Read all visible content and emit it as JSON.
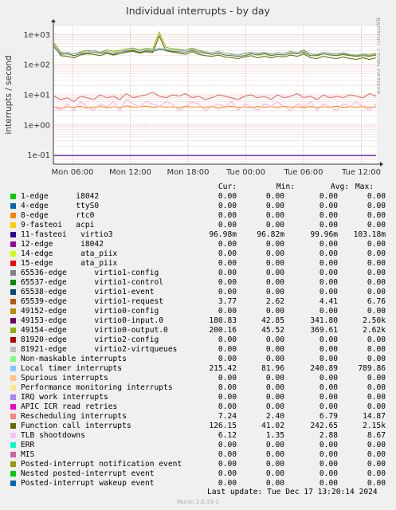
{
  "chart_data": {
    "type": "line",
    "title": "Individual interrupts - by day",
    "ylabel": "interrupts / second",
    "yscale": "log",
    "ylim": [
      0.05,
      2000
    ],
    "yticks": [
      "1e-01",
      "1e+00",
      "1e+01",
      "1e+02",
      "1e+03"
    ],
    "xticks": [
      "Mon 06:00",
      "Mon 12:00",
      "Mon 18:00",
      "Tue 00:00",
      "Tue 06:00",
      "Tue 12:00"
    ],
    "grid": true,
    "series": [
      {
        "name": "Local timer interrupts",
        "color": "#8fb4e0",
        "values": [
          420,
          240,
          260,
          230,
          250,
          270,
          300,
          260,
          280,
          250,
          270,
          300,
          330,
          290,
          320,
          300,
          350,
          330,
          310,
          300,
          290,
          330,
          280,
          260,
          250,
          270,
          240,
          220,
          210,
          230,
          250,
          240,
          260,
          230,
          250,
          240,
          270,
          250,
          290,
          230,
          220,
          260,
          240,
          230,
          250,
          220,
          210,
          230,
          220,
          240
        ]
      },
      {
        "name": "Function call interrupts",
        "color": "#4d7a2a",
        "values": [
          380,
          220,
          230,
          200,
          230,
          240,
          260,
          240,
          250,
          220,
          260,
          280,
          300,
          260,
          290,
          280,
          320,
          300,
          280,
          270,
          260,
          300,
          250,
          240,
          220,
          240,
          210,
          200,
          190,
          200,
          230,
          210,
          230,
          200,
          220,
          210,
          240,
          230,
          260,
          200,
          200,
          230,
          210,
          200,
          220,
          200,
          190,
          200,
          190,
          210
        ]
      },
      {
        "name": "49154-edge virtio0-output.0",
        "color": "#a0b300",
        "values": [
          520,
          260,
          250,
          230,
          270,
          300,
          290,
          260,
          310,
          280,
          300,
          330,
          360,
          310,
          350,
          330,
          1200,
          380,
          340,
          320,
          300,
          360,
          300,
          270,
          250,
          280,
          240,
          230,
          210,
          240,
          260,
          230,
          250,
          220,
          250,
          240,
          280,
          250,
          310,
          230,
          210,
          260,
          230,
          220,
          240,
          210,
          200,
          220,
          200,
          230
        ]
      },
      {
        "name": "49153-edge virtio0-input.0",
        "color": "#6b6b00",
        "values": [
          450,
          200,
          190,
          170,
          210,
          230,
          220,
          200,
          240,
          210,
          230,
          260,
          280,
          240,
          270,
          250,
          900,
          290,
          260,
          240,
          220,
          270,
          220,
          200,
          190,
          210,
          180,
          170,
          160,
          180,
          200,
          170,
          190,
          170,
          190,
          180,
          210,
          190,
          230,
          170,
          160,
          190,
          170,
          160,
          180,
          160,
          150,
          170,
          150,
          170
        ]
      },
      {
        "name": "Rescheduling interrupts",
        "color": "#e8706b",
        "values": [
          9,
          7,
          8,
          6,
          9,
          8,
          7,
          10,
          8,
          9,
          7,
          11,
          8,
          9,
          10,
          12,
          9,
          8,
          10,
          9,
          11,
          8,
          9,
          7,
          8,
          10,
          9,
          8,
          7,
          9,
          10,
          8,
          9,
          7,
          10,
          8,
          9,
          11,
          8,
          9,
          7,
          10,
          8,
          9,
          8,
          10,
          9,
          8,
          11,
          9
        ]
      },
      {
        "name": "TLB shootdowns",
        "color": "#ffb0e8",
        "values": [
          4,
          3,
          5,
          3,
          6,
          4,
          3,
          5,
          4,
          6,
          3,
          7,
          5,
          4,
          6,
          5,
          4,
          6,
          5,
          3,
          4,
          6,
          5,
          3,
          4,
          5,
          4,
          6,
          3,
          5,
          4,
          3,
          5,
          4,
          6,
          4,
          3,
          5,
          4,
          6,
          3,
          5,
          4,
          3,
          5,
          4,
          6,
          4,
          3,
          5
        ]
      },
      {
        "name": "65539-edge virtio1-request",
        "color": "#ff8c00",
        "values": [
          4,
          3.5,
          4,
          3.8,
          4.2,
          3.6,
          3.9,
          4.1,
          3.7,
          4,
          3.8,
          4.3,
          3.9,
          4,
          4.2,
          3.8,
          4.1,
          3.9,
          4,
          3.7,
          4.2,
          3.9,
          4,
          3.8,
          4.1,
          3.6,
          3.9,
          4.2,
          3.8,
          4,
          3.7,
          4.1,
          3.9,
          4,
          3.8,
          4.2,
          3.9,
          4,
          3.7,
          4.1,
          3.8,
          4,
          3.9,
          4.2,
          3.8,
          4,
          3.9,
          4.1,
          3.8,
          4
        ]
      },
      {
        "name": "11-fasteoi virtio3",
        "color": "#330099",
        "values": [
          0.097,
          0.097,
          0.097,
          0.097,
          0.097,
          0.097,
          0.097,
          0.097,
          0.097,
          0.097,
          0.097,
          0.097,
          0.097,
          0.097,
          0.097,
          0.097,
          0.097,
          0.097,
          0.097,
          0.097,
          0.097,
          0.097,
          0.097,
          0.097,
          0.097,
          0.097,
          0.097,
          0.097,
          0.097,
          0.097,
          0.097,
          0.097,
          0.097,
          0.097,
          0.097,
          0.097,
          0.097,
          0.097,
          0.097,
          0.097,
          0.097,
          0.097,
          0.097,
          0.097,
          0.097,
          0.097,
          0.097,
          0.097,
          0.097,
          0.097
        ]
      }
    ]
  },
  "legend": {
    "headers": {
      "cur": "Cur:",
      "min": "Min:",
      "avg": "Avg:",
      "max": "Max:"
    },
    "rows": [
      {
        "label": "1-edge      i8042",
        "color": "#00cc00",
        "cur": "0.00",
        "min": "0.00",
        "avg": "0.00",
        "max": "0.00"
      },
      {
        "label": "4-edge      ttyS0",
        "color": "#0066b3",
        "cur": "0.00",
        "min": "0.00",
        "avg": "0.00",
        "max": "0.00"
      },
      {
        "label": "8-edge      rtc0",
        "color": "#ff8000",
        "cur": "0.00",
        "min": "0.00",
        "avg": "0.00",
        "max": "0.00"
      },
      {
        "label": "9-fasteoi   acpi",
        "color": "#ffcc00",
        "cur": "0.00",
        "min": "0.00",
        "avg": "0.00",
        "max": "0.00"
      },
      {
        "label": "11-fasteoi   virtio3",
        "color": "#330099",
        "cur": "96.98m",
        "min": "96.82m",
        "avg": "99.96m",
        "max": "103.18m"
      },
      {
        "label": "12-edge      i8042",
        "color": "#990099",
        "cur": "0.00",
        "min": "0.00",
        "avg": "0.00",
        "max": "0.00"
      },
      {
        "label": "14-edge      ata_piix",
        "color": "#ccff00",
        "cur": "0.00",
        "min": "0.00",
        "avg": "0.00",
        "max": "0.00"
      },
      {
        "label": "15-edge      ata_piix",
        "color": "#ff0000",
        "cur": "0.00",
        "min": "0.00",
        "avg": "0.00",
        "max": "0.00"
      },
      {
        "label": "65536-edge      virtio1-config",
        "color": "#808080",
        "cur": "0.00",
        "min": "0.00",
        "avg": "0.00",
        "max": "0.00"
      },
      {
        "label": "65537-edge      virtio1-control",
        "color": "#008f00",
        "cur": "0.00",
        "min": "0.00",
        "avg": "0.00",
        "max": "0.00"
      },
      {
        "label": "65538-edge      virtio1-event",
        "color": "#00487d",
        "cur": "0.00",
        "min": "0.00",
        "avg": "0.00",
        "max": "0.00"
      },
      {
        "label": "65539-edge      virtio1-request",
        "color": "#b35a00",
        "cur": "3.77",
        "min": "2.62",
        "avg": "4.41",
        "max": "6.76"
      },
      {
        "label": "49152-edge      virtio0-config",
        "color": "#b38f00",
        "cur": "0.00",
        "min": "0.00",
        "avg": "0.00",
        "max": "0.00"
      },
      {
        "label": "49153-edge      virtio0-input.0",
        "color": "#6b006b",
        "cur": "180.83",
        "min": "42.85",
        "avg": "341.80",
        "max": "2.50k"
      },
      {
        "label": "49154-edge      virtio0-output.0",
        "color": "#8fb300",
        "cur": "200.16",
        "min": "45.52",
        "avg": "369.61",
        "max": "2.62k"
      },
      {
        "label": "81920-edge      virtio2-config",
        "color": "#b30000",
        "cur": "0.00",
        "min": "0.00",
        "avg": "0.00",
        "max": "0.00"
      },
      {
        "label": "81921-edge      virtio2-virtqueues",
        "color": "#bebebe",
        "cur": "0.00",
        "min": "0.00",
        "avg": "0.00",
        "max": "0.00"
      },
      {
        "label": "Non-maskable interrupts",
        "color": "#80ff80",
        "cur": "0.00",
        "min": "0.00",
        "avg": "0.00",
        "max": "0.00"
      },
      {
        "label": "Local timer interrupts",
        "color": "#80c9ff",
        "cur": "215.42",
        "min": "81.96",
        "avg": "240.89",
        "max": "789.86"
      },
      {
        "label": "Spurious interrupts",
        "color": "#ffc080",
        "cur": "0.00",
        "min": "0.00",
        "avg": "0.00",
        "max": "0.00"
      },
      {
        "label": "Performance monitoring interrupts",
        "color": "#ffe680",
        "cur": "0.00",
        "min": "0.00",
        "avg": "0.00",
        "max": "0.00"
      },
      {
        "label": "IRQ work interrupts",
        "color": "#aa80ff",
        "cur": "0.00",
        "min": "0.00",
        "avg": "0.00",
        "max": "0.00"
      },
      {
        "label": "APIC ICR read retries",
        "color": "#ee00cc",
        "cur": "0.00",
        "min": "0.00",
        "avg": "0.00",
        "max": "0.00"
      },
      {
        "label": "Rescheduling interrupts",
        "color": "#ff8080",
        "cur": "7.24",
        "min": "2.40",
        "avg": "6.79",
        "max": "14.87"
      },
      {
        "label": "Function call interrupts",
        "color": "#666600",
        "cur": "126.15",
        "min": "41.02",
        "avg": "242.65",
        "max": "2.15k"
      },
      {
        "label": "TLB shootdowns",
        "color": "#ffbfff",
        "cur": "6.12",
        "min": "1.35",
        "avg": "2.88",
        "max": "8.67"
      },
      {
        "label": "ERR",
        "color": "#00ffcc",
        "cur": "0.00",
        "min": "0.00",
        "avg": "0.00",
        "max": "0.00"
      },
      {
        "label": "MIS",
        "color": "#cc6699",
        "cur": "0.00",
        "min": "0.00",
        "avg": "0.00",
        "max": "0.00"
      },
      {
        "label": "Posted-interrupt notification event",
        "color": "#999900",
        "cur": "0.00",
        "min": "0.00",
        "avg": "0.00",
        "max": "0.00"
      },
      {
        "label": "Nested posted-interrupt event",
        "color": "#00cc00",
        "cur": "0.00",
        "min": "0.00",
        "avg": "0.00",
        "max": "0.00"
      },
      {
        "label": "Posted-interrupt wakeup event",
        "color": "#0066b3",
        "cur": "0.00",
        "min": "0.00",
        "avg": "0.00",
        "max": "0.00"
      }
    ]
  },
  "footer": {
    "last_update": "Last update:  Tue Dec 17 13:20:14 2024",
    "version": "Munin 2.0.33-1"
  },
  "side_text": "RRDTOOL / TOBI OETIKER"
}
